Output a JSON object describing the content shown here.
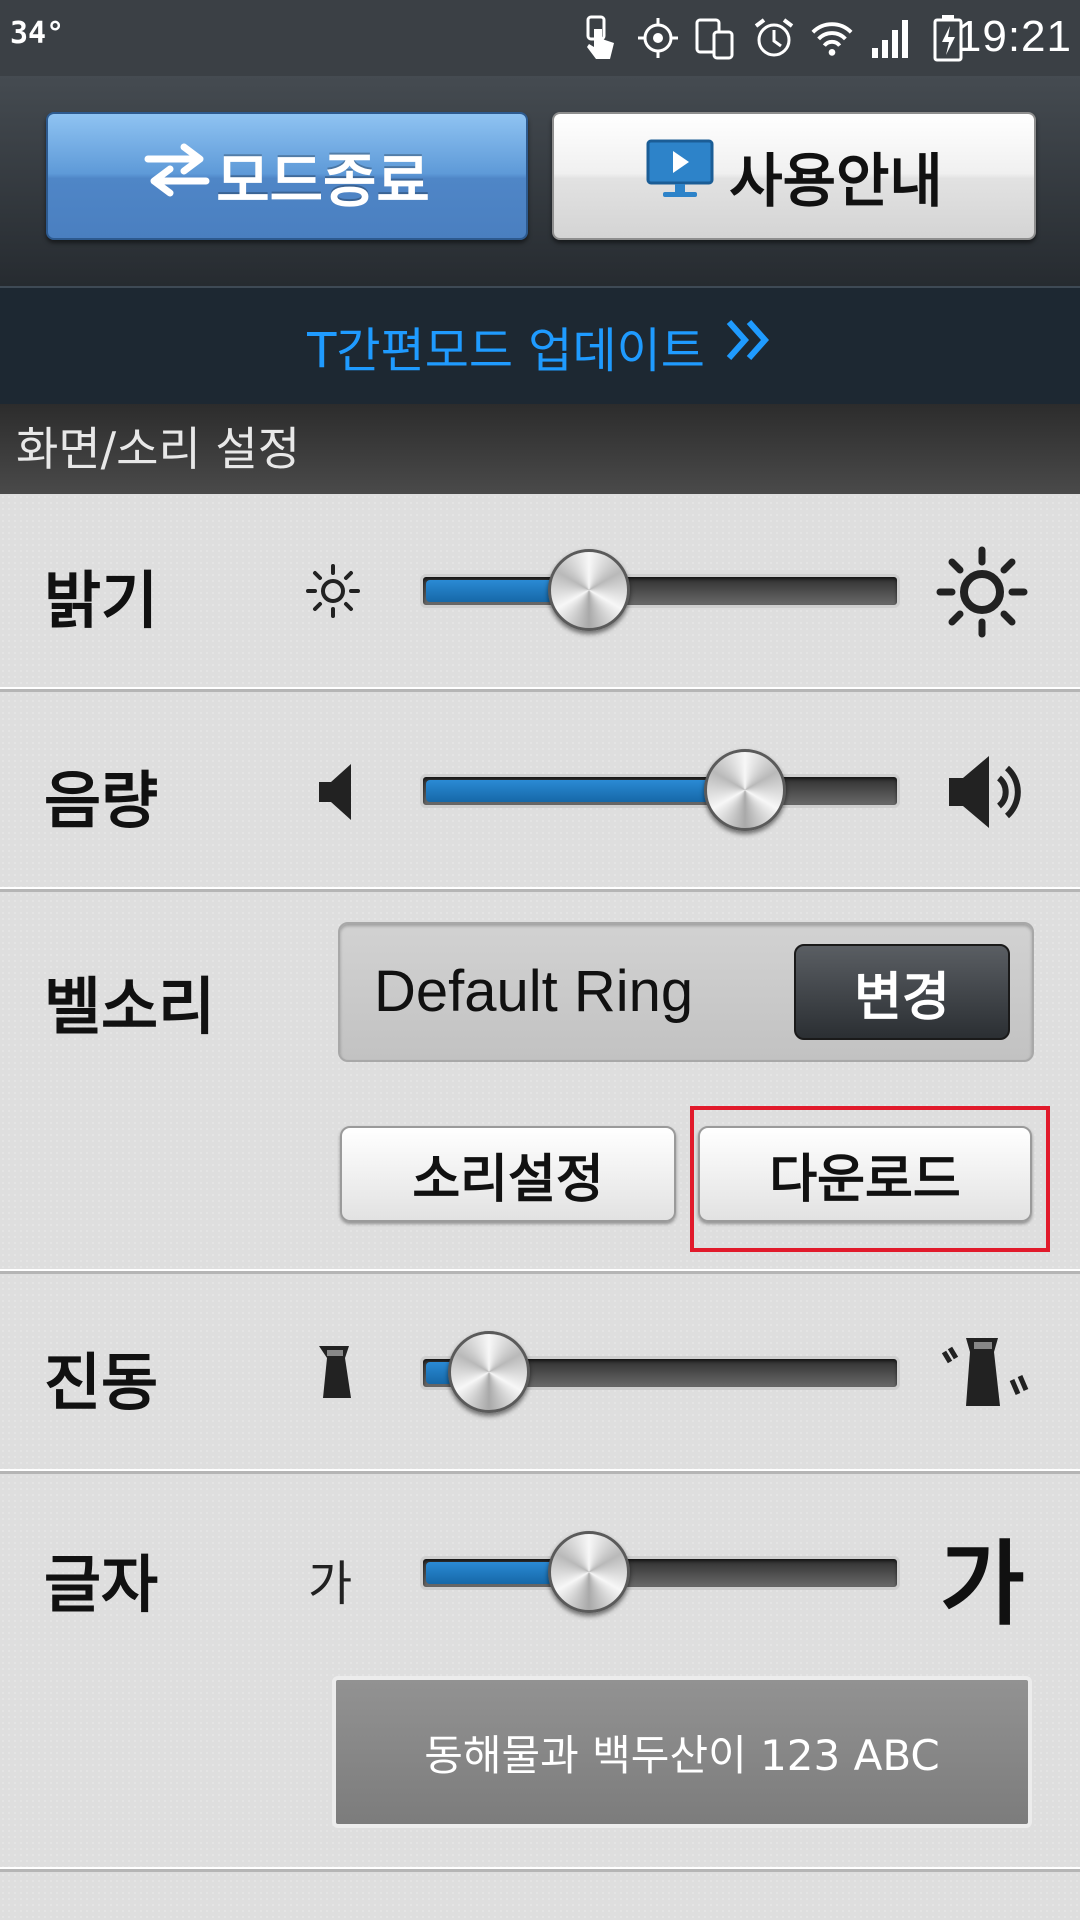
{
  "status_bar": {
    "temperature": "34°",
    "time": "19:21",
    "icons": [
      "touch-icon",
      "gps-icon",
      "device-icon",
      "alarm-icon",
      "wifi-icon",
      "signal-icon",
      "battery-icon"
    ]
  },
  "top_buttons": {
    "exit_label": "모드종료",
    "guide_label": "사용안내"
  },
  "update_banner": {
    "label": "T간편모드 업데이트"
  },
  "section": {
    "title": "화면/소리 설정"
  },
  "brightness": {
    "label": "밝기",
    "level": 0.35
  },
  "volume": {
    "label": "음량",
    "level": 0.68
  },
  "ringtone": {
    "label": "벨소리",
    "current": "Default Ring",
    "change_label": "변경",
    "sound_settings_label": "소리설정",
    "download_label": "다운로드"
  },
  "vibration": {
    "label": "진동",
    "level": 0.14
  },
  "font_size": {
    "label": "글자",
    "small_glyph": "가",
    "large_glyph": "가",
    "level": 0.35,
    "preview": "동해물과 백두산이 123 ABC"
  },
  "colors": {
    "accent_blue": "#1f9bff",
    "highlight_red": "#e11a2b"
  }
}
